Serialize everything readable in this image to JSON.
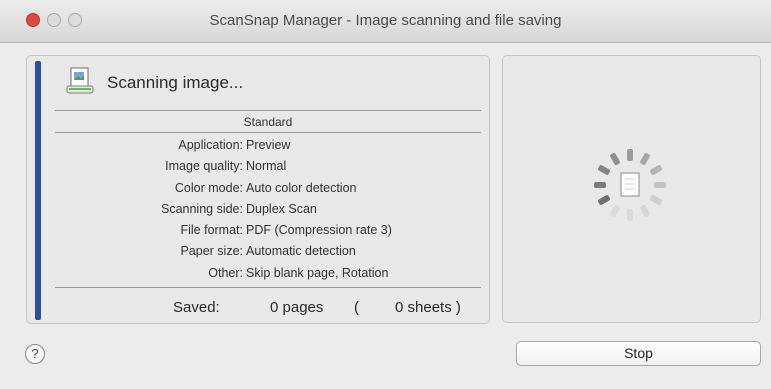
{
  "window": {
    "title": "ScanSnap Manager - Image scanning and file saving",
    "colors": {
      "close": "#e0483e",
      "accent_bar": "#2d4f9c"
    }
  },
  "status": {
    "icon": "scanner-document-icon",
    "text": "Scanning image..."
  },
  "profile": "Standard",
  "settings": [
    {
      "label": "Application:",
      "value": "Preview"
    },
    {
      "label": "Image quality:",
      "value": "Normal"
    },
    {
      "label": "Color mode:",
      "value": "Auto color detection"
    },
    {
      "label": "Scanning side:",
      "value": "Duplex Scan"
    },
    {
      "label": "File format:",
      "value": "PDF (Compression rate 3)"
    },
    {
      "label": "Paper size:",
      "value": "Automatic detection"
    },
    {
      "label": "Other:",
      "value": "Skip blank page, Rotation"
    }
  ],
  "saved": {
    "label": "Saved:",
    "pages": "0 pages",
    "open_paren": "(",
    "sheets": "0 sheets )"
  },
  "preview": {
    "icon": "progress-spinner-icon"
  },
  "footer": {
    "help_label": "?",
    "stop_label": "Stop"
  }
}
